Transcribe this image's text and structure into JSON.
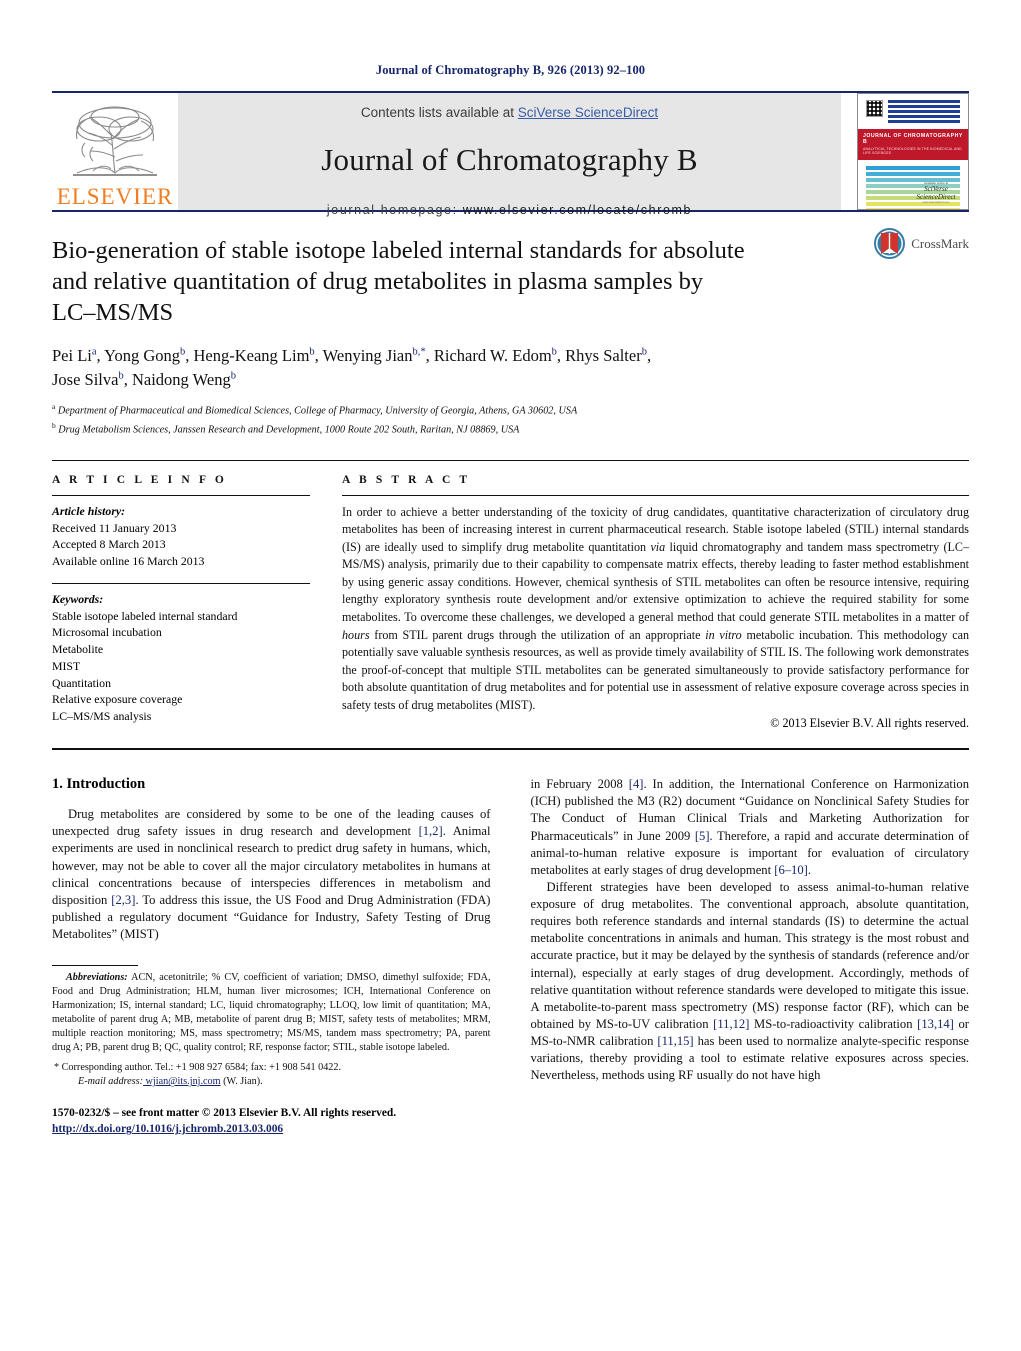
{
  "running_head": "Journal of Chromatography B, 926 (2013) 92–100",
  "masthead": {
    "publisher_logo_text": "ELSEVIER",
    "contents_prefix": "Contents lists available at ",
    "contents_link": "SciVerse ScienceDirect",
    "journal_title": "Journal of Chromatography B",
    "homepage_prefix": "journal homepage: ",
    "homepage_url": "www.elsevier.com/locate/chromb",
    "cover": {
      "band_title": "JOURNAL OF CHROMATOGRAPHY B",
      "band_subtitle": "ANALYTICAL TECHNOLOGIES IN THE BIOMEDICAL AND LIFE SCIENCES",
      "footer_line1": "Available online at",
      "footer_line2": "SciVerse ScienceDirect",
      "footer_line3": "www.sciencedirect.com"
    }
  },
  "article": {
    "title": "Bio-generation of stable isotope labeled internal standards for absolute and relative quantitation of drug metabolites in plasma samples by LC–MS/MS",
    "crossmark_label": "CrossMark",
    "authors_line1": "Pei Li a, Yong Gong b, Heng-Keang Lim b, Wenying Jian b,*, Richard W. Edom b, Rhys Salter b,",
    "authors_line2": "Jose Silva b, Naidong Weng b",
    "affiliation_a": "Department of Pharmaceutical and Biomedical Sciences, College of Pharmacy, University of Georgia, Athens, GA 30602, USA",
    "affiliation_b": "Drug Metabolism Sciences, Janssen Research and Development, 1000 Route 202 South, Raritan, NJ 08869, USA"
  },
  "article_info": {
    "heading": "A R T I C L E   I N F O",
    "history_label": "Article history:",
    "history": [
      "Received 11 January 2013",
      "Accepted 8 March 2013",
      "Available online 16 March 2013"
    ],
    "keywords_label": "Keywords:",
    "keywords": [
      "Stable isotope labeled internal standard",
      "Microsomal incubation",
      "Metabolite",
      "MIST",
      "Quantitation",
      "Relative exposure coverage",
      "LC–MS/MS analysis"
    ]
  },
  "abstract": {
    "heading": "A B S T R A C T",
    "text_part1": "In order to achieve a better understanding of the toxicity of drug candidates, quantitative characterization of circulatory drug metabolites has been of increasing interest in current pharmaceutical research. Stable isotope labeled (STIL) internal standards (IS) are ideally used to simplify drug metabolite quantitation ",
    "italic1": "via",
    "text_part2": " liquid chromatography and tandem mass spectrometry (LC–MS/MS) analysis, primarily due to their capability to compensate matrix effects, thereby leading to faster method establishment by using generic assay conditions. However, chemical synthesis of STIL metabolites can often be resource intensive, requiring lengthy exploratory synthesis route development and/or extensive optimization to achieve the required stability for some metabolites. To overcome these challenges, we developed a general method that could generate STIL metabolites in a matter of ",
    "italic2": "hours",
    "text_part3": " from STIL parent drugs through the utilization of an appropriate ",
    "italic3": "in vitro",
    "text_part4": " metabolic incubation. This methodology can potentially save valuable synthesis resources, as well as provide timely availability of STIL IS. The following work demonstrates the proof-of-concept that multiple STIL metabolites can be generated simultaneously to provide satisfactory performance for both absolute quantitation of drug metabolites and for potential use in assessment of relative exposure coverage across species in safety tests of drug metabolites (MIST).",
    "copyright": "© 2013 Elsevier B.V. All rights reserved."
  },
  "introduction": {
    "section_title": "1.  Introduction",
    "left_para1": "Drug metabolites are considered by some to be one of the leading causes of unexpected drug safety issues in drug research and development [1,2]. Animal experiments are used in nonclinical research to predict drug safety in humans, which, however, may not be able to cover all the major circulatory metabolites in humans at clinical concentrations because of interspecies differences in metabolism and disposition [2,3]. To address this issue, the US Food and Drug Administration (FDA) published a regulatory document “Guidance for Industry, Safety Testing of Drug Metabolites” (MIST)",
    "right_para1": "in February 2008 [4]. In addition, the International Conference on Harmonization (ICH) published the M3 (R2) document “Guidance on Nonclinical Safety Studies for The Conduct of Human Clinical Trials and Marketing Authorization for Pharmaceuticals” in June 2009 [5]. Therefore, a rapid and accurate determination of animal-to-human relative exposure is important for evaluation of circulatory metabolites at early stages of drug development [6–10].",
    "right_para2": "Different strategies have been developed to assess animal-to-human relative exposure of drug metabolites. The conventional approach, absolute quantitation, requires both reference standards and internal standards (IS) to determine the actual metabolite concentrations in animals and human. This strategy is the most robust and accurate practice, but it may be delayed by the synthesis of standards (reference and/or internal), especially at early stages of drug development. Accordingly, methods of relative quantitation without reference standards were developed to mitigate this issue. A metabolite-to-parent mass spectrometry (MS) response factor (RF), which can be obtained by MS-to-UV calibration [11,12] MS-to-radioactivity calibration [13,14] or MS-to-NMR calibration [11,15] has been used to normalize analyte-specific response variations, thereby providing a tool to estimate relative exposures across species. Nevertheless, methods using RF usually do not have high"
  },
  "footnotes": {
    "abbrev_label": "Abbreviations:",
    "abbrev_text": " ACN, acetonitrile; % CV, coefficient of variation; DMSO, dimethyl sulfoxide; FDA, Food and Drug Administration; HLM, human liver microsomes; ICH, International Conference on Harmonization; IS, internal standard; LC, liquid chromatography; LLOQ, low limit of quantitation; MA, metabolite of parent drug A; MB, metabolite of parent drug B; MIST, safety tests of metabolites; MRM, multiple reaction monitoring; MS, mass spectrometry; MS/MS, tandem mass spectrometry; PA, parent drug A; PB, parent drug B; QC, quality control; RF, response factor; STIL, stable isotope labeled.",
    "corresponding_star": "*",
    "corresponding_text": " Corresponding author. Tel.: +1 908 927 6584; fax: +1 908 541 0422.",
    "email_label": "E-mail address:",
    "email_value": " wjian@its.jnj.com",
    "email_owner": " (W. Jian)."
  },
  "footer": {
    "issn_line": "1570-0232/$ – see front matter © 2013 Elsevier B.V. All rights reserved.",
    "doi_line": "http://dx.doi.org/10.1016/j.jchromb.2013.03.006"
  },
  "colors": {
    "navy": "#17256b",
    "elsevier_orange": "#ef7d22",
    "link_blue": "#3b5ca8",
    "masthead_grey": "#e6e6e6",
    "crossmark_red": "#d0342c"
  }
}
